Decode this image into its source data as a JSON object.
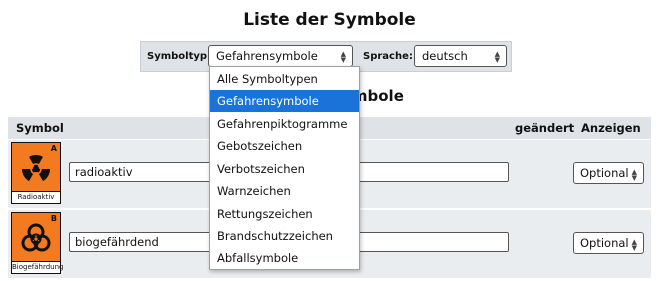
{
  "page": {
    "title": "Liste der Symbole",
    "subtitle": "Gefahrensymbole"
  },
  "filter": {
    "type_label": "Symboltyp:",
    "type_value": "Gefahrensymbole",
    "lang_label": "Sprache:",
    "lang_value": "deutsch"
  },
  "dropdown": {
    "options": [
      "Alle Symboltypen",
      "Gefahrensymbole",
      "Gefahrenpiktogramme",
      "Gebotszeichen",
      "Verbotszeichen",
      "Warnzeichen",
      "Rettungszeichen",
      "Brandschutzzeichen",
      "Abfallsymbole"
    ],
    "selected_index": 1
  },
  "table": {
    "headers": {
      "symbol": "Symbol",
      "changed": "geändert",
      "show": "Anzeigen"
    },
    "rows": [
      {
        "sign_letter": "A",
        "sign_caption": "Radioaktiv",
        "icon": "radioactive-icon",
        "name": "radioaktiv",
        "display": "Optional"
      },
      {
        "sign_letter": "B",
        "sign_caption": "Biogefährdung",
        "icon": "biohazard-icon",
        "name": "biogefährdend",
        "display": "Optional"
      }
    ]
  },
  "colors": {
    "sign_orange": "#f47a1f",
    "highlight": "#1a73d9",
    "header_bg": "#dfe3e8"
  }
}
